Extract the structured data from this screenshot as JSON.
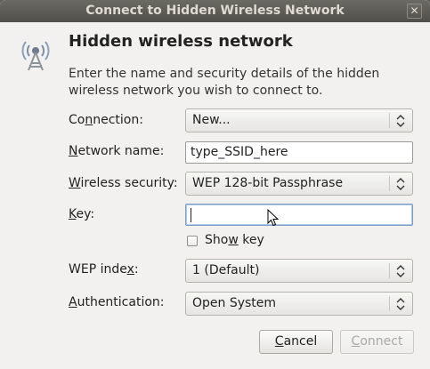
{
  "window": {
    "title": "Connect to Hidden Wireless Network",
    "close_symbol": "✕"
  },
  "header": {
    "icon": "wireless-network-icon",
    "heading": "Hidden wireless network",
    "description": "Enter the name and security details of the hidden wireless network you wish to connect to."
  },
  "form": {
    "connection": {
      "label_pre": "Co",
      "label_mn": "n",
      "label_post": "nection:",
      "value": "New..."
    },
    "network_name": {
      "label_pre": "",
      "label_mn": "N",
      "label_post": "etwork name:",
      "value": "type_SSID_here"
    },
    "wireless_security": {
      "label_pre": "",
      "label_mn": "W",
      "label_post": "ireless security:",
      "value": "WEP 128-bit Passphrase"
    },
    "key": {
      "label_pre": "",
      "label_mn": "K",
      "label_post": "ey:",
      "value": ""
    },
    "show_key": {
      "label_pre": "Sho",
      "label_mn": "w",
      "label_post": " key",
      "checked": false
    },
    "wep_index": {
      "label_pre": "WEP inde",
      "label_mn": "x",
      "label_post": ":",
      "value": "1 (Default)"
    },
    "authentication": {
      "label_pre": "",
      "label_mn": "A",
      "label_post": "uthentication:",
      "value": "Open System"
    }
  },
  "buttons": {
    "cancel": {
      "label_pre": "",
      "label_mn": "C",
      "label_post": "ancel"
    },
    "connect": {
      "label_pre": "",
      "label_mn": "C",
      "label_post": "onnect",
      "disabled": true
    }
  }
}
